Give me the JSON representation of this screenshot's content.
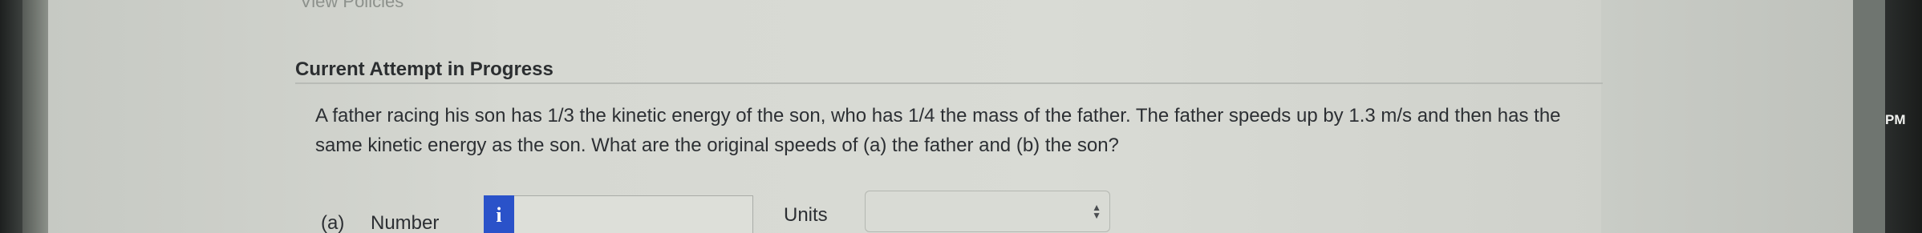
{
  "header": {
    "view_policies": "View Policies",
    "attempt_title": "Current Attempt in Progress"
  },
  "question": {
    "text": "A father racing his son has 1/3 the kinetic energy of the son, who has 1/4 the mass of the father. The father speeds up by 1.3 m/s and then has the same kinetic energy as the son. What are the original speeds of (a) the father and (b) the son?"
  },
  "answer_a": {
    "part_label": "(a)",
    "number_label": "Number",
    "info_icon": "i",
    "number_value": "",
    "units_label": "Units",
    "units_selected": ""
  },
  "system": {
    "clock_badge": "PM"
  },
  "colors": {
    "info_icon_bg": "#2a52c9",
    "text": "#2c2f33"
  }
}
